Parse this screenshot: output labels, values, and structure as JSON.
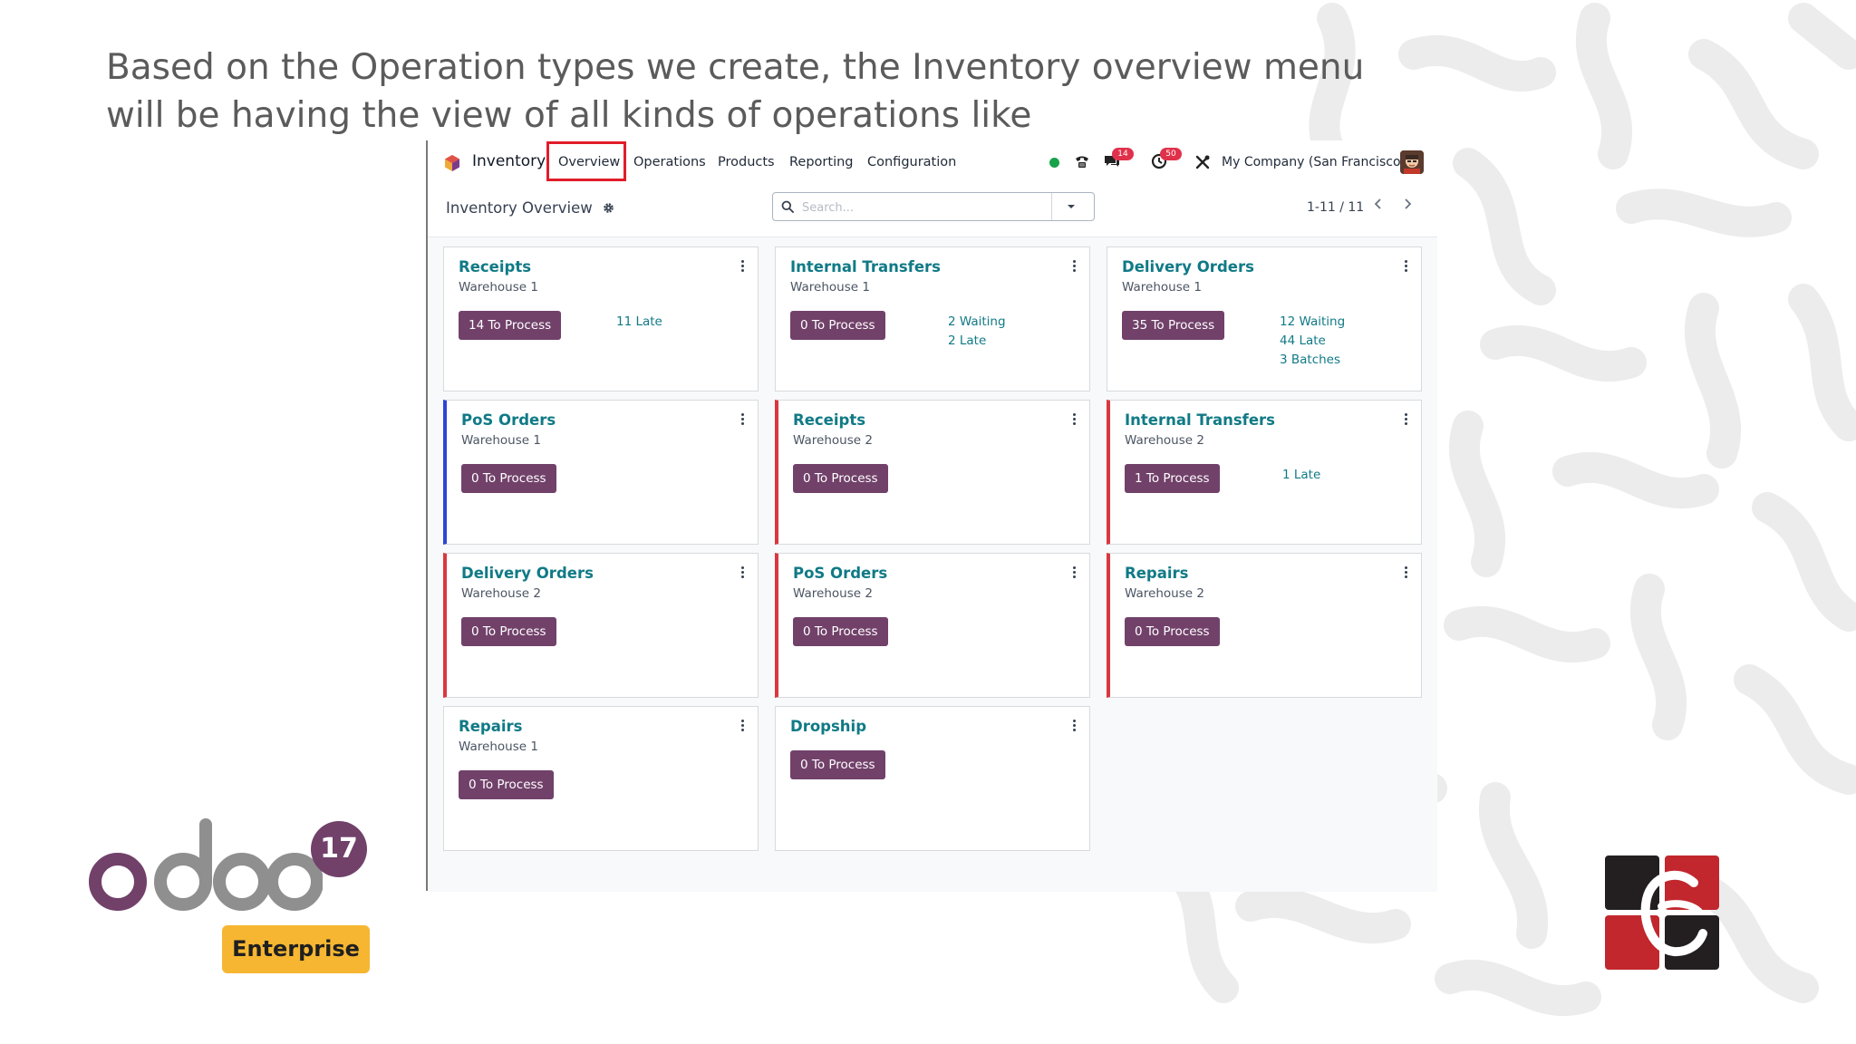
{
  "slide": {
    "title": "Based on the Operation types we create, the Inventory overview menu will be having the view of all kinds of operations like"
  },
  "navbar": {
    "app_name": "Inventory",
    "menu": [
      {
        "label": "Overview"
      },
      {
        "label": "Operations"
      },
      {
        "label": "Products"
      },
      {
        "label": "Reporting"
      },
      {
        "label": "Configuration"
      }
    ],
    "messages_count": "14",
    "activities_count": "50",
    "company": "My Company (San Francisco)"
  },
  "controlbar": {
    "breadcrumb": "Inventory Overview",
    "search_placeholder": "Search...",
    "pager_value": "1-11 / 11"
  },
  "cards": [
    {
      "title": "Receipts",
      "subtitle": "Warehouse 1",
      "button": "14 To Process",
      "stats": [
        "11 Late"
      ]
    },
    {
      "title": "Internal Transfers",
      "subtitle": "Warehouse 1",
      "button": "0 To Process",
      "stats": [
        "2 Waiting",
        "2 Late"
      ]
    },
    {
      "title": "Delivery Orders",
      "subtitle": "Warehouse 1",
      "button": "35 To Process",
      "stats": [
        "12 Waiting",
        "44 Late",
        "3 Batches"
      ]
    },
    {
      "title": "PoS Orders",
      "subtitle": "Warehouse 1",
      "button": "0 To Process",
      "stats": []
    },
    {
      "title": "Receipts",
      "subtitle": "Warehouse 2",
      "button": "0 To Process",
      "stats": []
    },
    {
      "title": "Internal Transfers",
      "subtitle": "Warehouse 2",
      "button": "1 To Process",
      "stats": [
        "1 Late"
      ]
    },
    {
      "title": "Delivery Orders",
      "subtitle": "Warehouse 2",
      "button": "0 To Process",
      "stats": []
    },
    {
      "title": "PoS Orders",
      "subtitle": "Warehouse 2",
      "button": "0 To Process",
      "stats": []
    },
    {
      "title": "Repairs",
      "subtitle": "Warehouse 2",
      "button": "0 To Process",
      "stats": []
    },
    {
      "title": "Repairs",
      "subtitle": "Warehouse 1",
      "button": "0 To Process",
      "stats": []
    },
    {
      "title": "Dropship",
      "subtitle": "",
      "button": "0 To Process",
      "stats": []
    }
  ],
  "branding": {
    "version": "17",
    "edition": "Enterprise"
  },
  "colors": {
    "primary": "#71416a",
    "link": "#107a86",
    "highlight": "#e11d2a",
    "edition_badge": "#f6b632"
  }
}
